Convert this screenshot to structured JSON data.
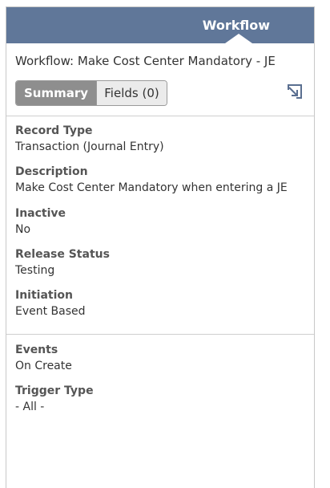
{
  "header": {
    "tab_label": "Workflow"
  },
  "title": "Workflow: Make Cost Center Mandatory - JE",
  "tabs": [
    {
      "label": "Summary",
      "active": true
    },
    {
      "label": "Fields (0)",
      "active": false
    }
  ],
  "icons": {
    "open": "open-in-new-icon"
  },
  "colors": {
    "header_bg": "#607799",
    "active_tab_bg": "#8e8e8e",
    "inactive_tab_bg": "#ebebeb",
    "icon": "#5a6f90"
  },
  "section_one": {
    "fields": [
      {
        "label": "Record Type",
        "value": "Transaction (Journal Entry)"
      },
      {
        "label": "Description",
        "value": "Make Cost Center Mandatory when entering a JE"
      },
      {
        "label": "Inactive",
        "value": "No"
      },
      {
        "label": "Release Status",
        "value": "Testing"
      },
      {
        "label": "Initiation",
        "value": "Event Based"
      }
    ]
  },
  "section_two": {
    "fields": [
      {
        "label": "Events",
        "value": "On Create"
      },
      {
        "label": "Trigger Type",
        "value": "- All -"
      }
    ]
  }
}
